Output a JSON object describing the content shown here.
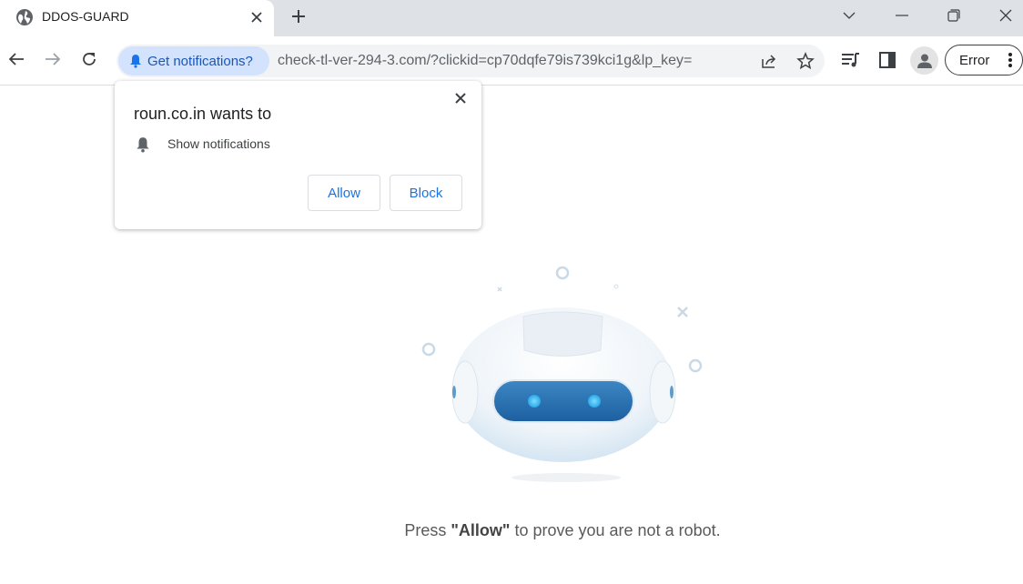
{
  "browser": {
    "tab": {
      "title": "DDOS-GUARD",
      "favicon": "globe-icon"
    },
    "window_controls": [
      "tab-search",
      "minimize",
      "restore",
      "close"
    ],
    "omnibox": {
      "chip_label": "Get notifications?",
      "url": "check-tl-ver-294-3.com/?clickid=cp70dqfe79is739kci1g&lp_key="
    },
    "profile_button_label": "Error"
  },
  "permission_popup": {
    "title": "roun.co.in wants to",
    "permission": "Show notifications",
    "allow_label": "Allow",
    "block_label": "Block"
  },
  "page": {
    "caption_before": "Press ",
    "caption_bold": "\"Allow\"",
    "caption_after": " to prove you are not a robot."
  },
  "colors": {
    "accent": "#1a73e8",
    "chip_bg": "#d3e3fd",
    "chip_text": "#1a56b8"
  }
}
